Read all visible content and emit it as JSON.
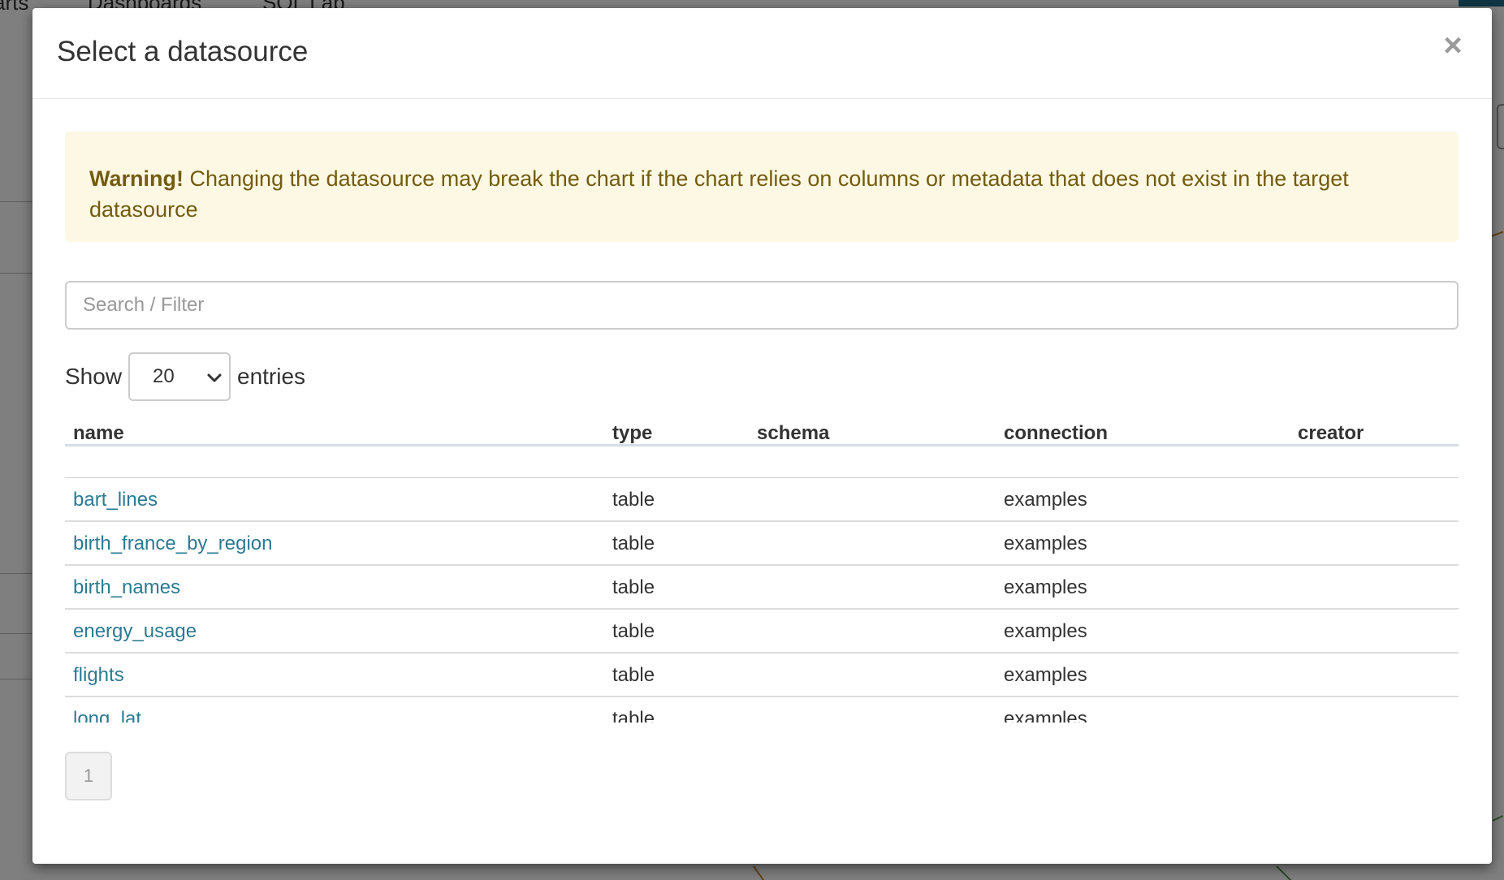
{
  "background_nav": {
    "item_1": "arts",
    "item_2": "Dashboards",
    "item_3": "SQL Lab",
    "item_3_caret": "▾"
  },
  "modal": {
    "title": "Select a datasource",
    "close_label": "×",
    "warning": {
      "strong": "Warning!",
      "text": " Changing the datasource may break the chart if the chart relies on columns or metadata that does not exist in the target datasource"
    },
    "search": {
      "placeholder": "Search / Filter",
      "value": ""
    },
    "page_size": {
      "show_label": "Show",
      "selected": "20",
      "entries_label": "entries"
    },
    "table": {
      "columns": [
        "name",
        "type",
        "schema",
        "connection",
        "creator"
      ],
      "rows": [
        {
          "name": "bart_lines",
          "type": "table",
          "schema": "",
          "connection": "examples",
          "creator": ""
        },
        {
          "name": "birth_france_by_region",
          "type": "table",
          "schema": "",
          "connection": "examples",
          "creator": ""
        },
        {
          "name": "birth_names",
          "type": "table",
          "schema": "",
          "connection": "examples",
          "creator": ""
        },
        {
          "name": "energy_usage",
          "type": "table",
          "schema": "",
          "connection": "examples",
          "creator": ""
        },
        {
          "name": "flights",
          "type": "table",
          "schema": "",
          "connection": "examples",
          "creator": ""
        },
        {
          "name": "long_lat",
          "type": "table",
          "schema": "",
          "connection": "examples",
          "creator": ""
        }
      ]
    },
    "pagination": {
      "current_page": "1"
    }
  },
  "colors": {
    "link": "#2c7a92",
    "warning_bg": "#fcf8e3",
    "warning_text": "#735c0f",
    "accent": "#1f6b84"
  }
}
